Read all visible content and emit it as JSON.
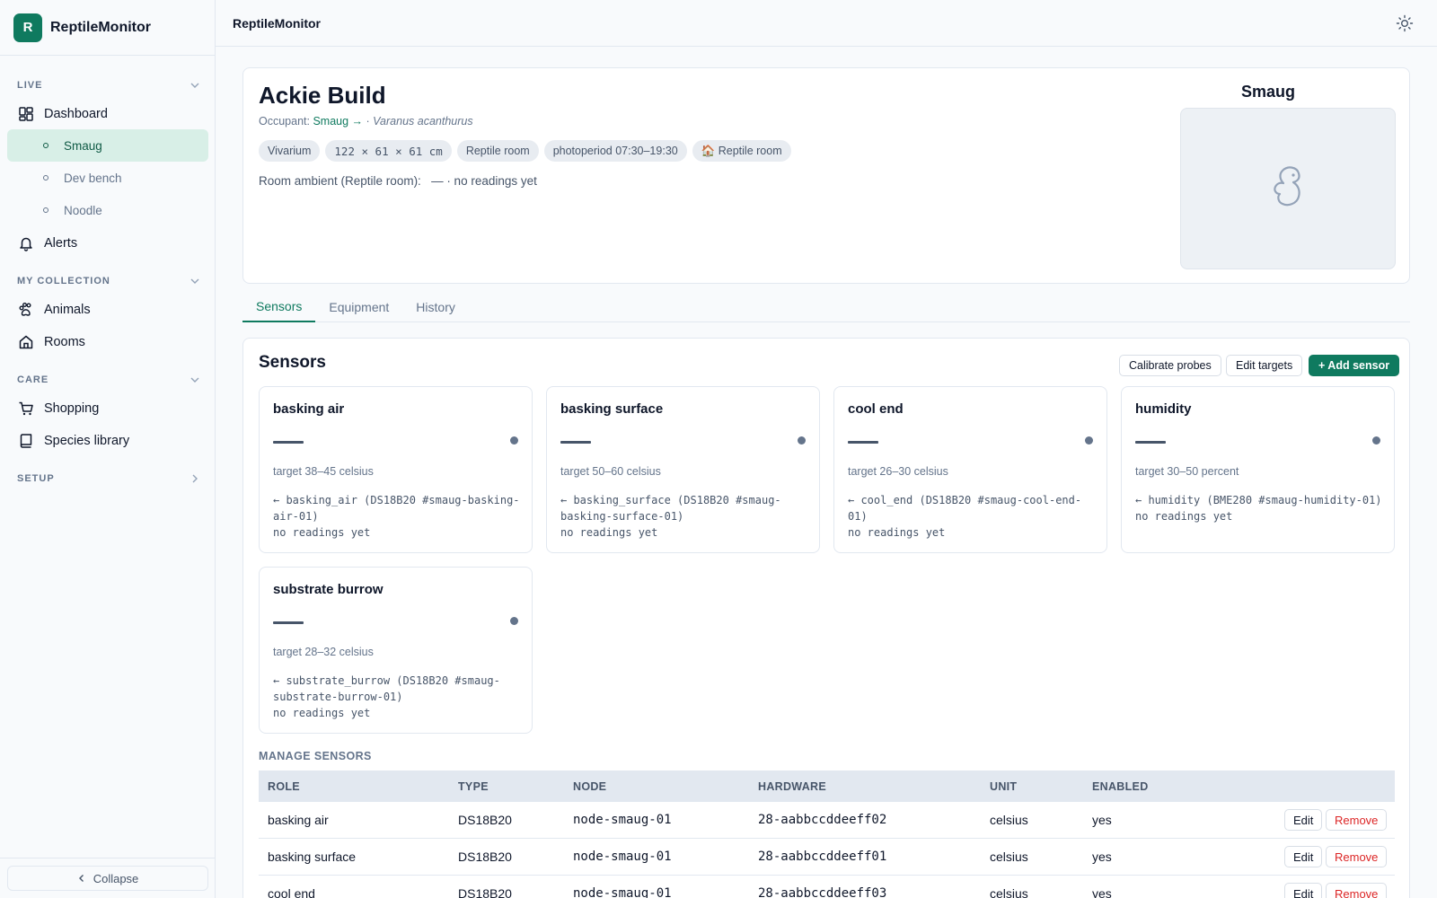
{
  "app": {
    "logo_letter": "R",
    "name": "ReptileMonitor"
  },
  "topbar": {
    "title": "ReptileMonitor"
  },
  "sidebar": {
    "sections": [
      {
        "label": "LIVE"
      },
      {
        "label": "MY COLLECTION"
      },
      {
        "label": "CARE"
      },
      {
        "label": "SETUP"
      }
    ],
    "dashboard": "Dashboard",
    "enclosures": [
      "Smaug",
      "Dev bench",
      "Noodle"
    ],
    "alerts": "Alerts",
    "animals": "Animals",
    "rooms": "Rooms",
    "shopping": "Shopping",
    "species_library": "Species library",
    "collapse": "Collapse"
  },
  "enclosure": {
    "title": "Ackie Build",
    "occupant_label": "Occupant:",
    "occupant_name": "Smaug →",
    "separator": " · ",
    "species": "Varanus acanthurus",
    "chips": [
      "Vivarium",
      "122 × 61 × 61 cm",
      "Reptile room",
      "photoperiod 07:30–19:30",
      "🏠 Reptile room"
    ],
    "ambient": "Room ambient (Reptile room):   — · no readings yet",
    "animal_name": "Smaug"
  },
  "tabs": [
    "Sensors",
    "Equipment",
    "History"
  ],
  "sensors": {
    "title": "Sensors",
    "buttons": {
      "calibrate": "Calibrate probes",
      "edit_targets": "Edit targets",
      "add": "+ Add sensor"
    },
    "cards": [
      {
        "name": "basking air",
        "target": "target 38–45 celsius",
        "source": "← basking_air (DS18B20 #smaug-basking-air-01)",
        "status": "no readings yet"
      },
      {
        "name": "basking surface",
        "target": "target 50–60 celsius",
        "source": "← basking_surface (DS18B20 #smaug-basking-surface-01)",
        "status": "no readings yet"
      },
      {
        "name": "cool end",
        "target": "target 26–30 celsius",
        "source": "← cool_end (DS18B20 #smaug-cool-end-01)",
        "status": "no readings yet"
      },
      {
        "name": "humidity",
        "target": "target 30–50 percent",
        "source": "← humidity (BME280 #smaug-humidity-01)",
        "status": "no readings yet"
      },
      {
        "name": "substrate burrow",
        "target": "target 28–32 celsius",
        "source": "← substrate_burrow (DS18B20 #smaug-substrate-burrow-01)",
        "status": "no readings yet"
      }
    ],
    "manage_label": "MANAGE SENSORS",
    "columns": [
      "ROLE",
      "TYPE",
      "NODE",
      "HARDWARE",
      "UNIT",
      "ENABLED"
    ],
    "rows": [
      {
        "role": "basking air",
        "type": "DS18B20",
        "node": "node-smaug-01",
        "hardware": "28-aabbccddeeff02",
        "unit": "celsius",
        "enabled": "yes"
      },
      {
        "role": "basking surface",
        "type": "DS18B20",
        "node": "node-smaug-01",
        "hardware": "28-aabbccddeeff01",
        "unit": "celsius",
        "enabled": "yes"
      },
      {
        "role": "cool end",
        "type": "DS18B20",
        "node": "node-smaug-01",
        "hardware": "28-aabbccddeeff03",
        "unit": "celsius",
        "enabled": "yes"
      }
    ],
    "row_actions": {
      "edit": "Edit",
      "remove": "Remove"
    }
  }
}
